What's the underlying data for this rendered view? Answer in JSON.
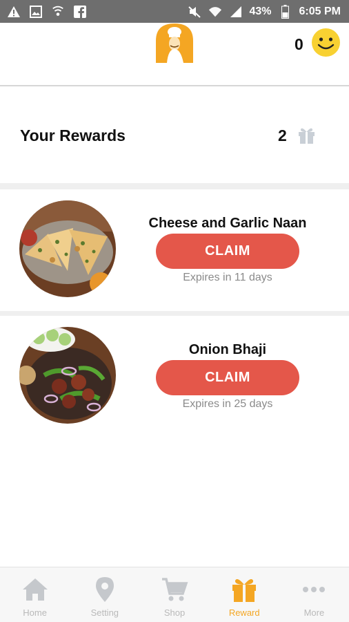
{
  "status_bar": {
    "battery": "43%",
    "time": "6:05 PM",
    "icons": [
      "warning-icon",
      "image-icon",
      "wifi-calling-icon",
      "facebook-icon",
      "mute-icon",
      "wifi-icon",
      "signal-icon",
      "battery-icon"
    ]
  },
  "header": {
    "points": "0",
    "logo_icon": "chef-logo-icon",
    "avatar_icon": "smiley-icon"
  },
  "rewards": {
    "title": "Your Rewards",
    "count": "2",
    "items": [
      {
        "name": "Cheese and Garlic Naan",
        "claim_label": "CLAIM",
        "expires": "Expires in 11 days"
      },
      {
        "name": "Onion Bhaji",
        "claim_label": "CLAIM",
        "expires": "Expires in 25 days"
      }
    ]
  },
  "nav": {
    "items": [
      {
        "label": "Home",
        "icon": "home-icon",
        "active": false
      },
      {
        "label": "Setting",
        "icon": "location-pin-icon",
        "active": false
      },
      {
        "label": "Shop",
        "icon": "cart-icon",
        "active": false
      },
      {
        "label": "Reward",
        "icon": "gift-icon",
        "active": true
      },
      {
        "label": "More",
        "icon": "more-dots-icon",
        "active": false
      }
    ]
  },
  "colors": {
    "accent": "#f4a623",
    "claim": "#e4574a",
    "status_bar": "#6e6e6e"
  }
}
